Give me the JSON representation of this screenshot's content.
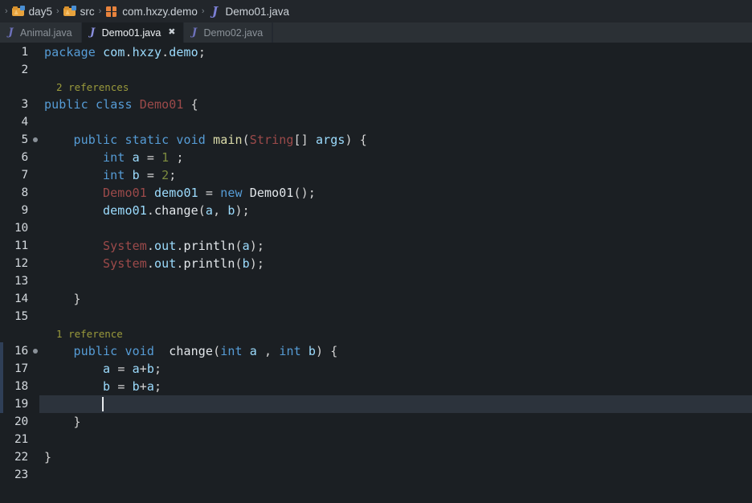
{
  "breadcrumb": {
    "items": [
      {
        "icon": "folder-icon",
        "label": "day5"
      },
      {
        "icon": "folder-icon",
        "label": "src"
      },
      {
        "icon": "package-icon",
        "label": "com.hxzy.demo"
      },
      {
        "icon": "java-file-icon",
        "label": "Demo01.java"
      }
    ],
    "separator": "›"
  },
  "tabs": [
    {
      "label": "Animal.java",
      "icon": "java-file-icon",
      "active": false,
      "close": ""
    },
    {
      "label": "Demo01.java",
      "icon": "java-file-icon",
      "active": true,
      "close": "✖"
    },
    {
      "label": "Demo02.java",
      "icon": "java-file-icon",
      "active": false,
      "close": ""
    }
  ],
  "editor": {
    "language": "java",
    "active_line": 19,
    "caret_line": 19,
    "caret_column": 9,
    "codelens": [
      {
        "after_line": 2,
        "text": "2 references"
      },
      {
        "after_line": 15,
        "text": "1 reference"
      }
    ],
    "run_markers": [
      5,
      16
    ],
    "edited_lines": [
      16,
      17,
      18,
      19
    ],
    "lines": [
      {
        "n": 1,
        "text": "package com.hxzy.demo;"
      },
      {
        "n": 2,
        "text": ""
      },
      {
        "n": 3,
        "text": "public class Demo01 {"
      },
      {
        "n": 4,
        "text": ""
      },
      {
        "n": 5,
        "text": "    public static void main(String[] args) {"
      },
      {
        "n": 6,
        "text": "        int a = 1 ;"
      },
      {
        "n": 7,
        "text": "        int b = 2;"
      },
      {
        "n": 8,
        "text": "        Demo01 demo01 = new Demo01();"
      },
      {
        "n": 9,
        "text": "        demo01.change(a, b);"
      },
      {
        "n": 10,
        "text": ""
      },
      {
        "n": 11,
        "text": "        System.out.println(a);"
      },
      {
        "n": 12,
        "text": "        System.out.println(b);"
      },
      {
        "n": 13,
        "text": ""
      },
      {
        "n": 14,
        "text": "    }"
      },
      {
        "n": 15,
        "text": ""
      },
      {
        "n": 16,
        "text": "    public void  change(int a , int b) {"
      },
      {
        "n": 17,
        "text": "        a = a+b;"
      },
      {
        "n": 18,
        "text": "        b = b+a;"
      },
      {
        "n": 19,
        "text": ""
      },
      {
        "n": 20,
        "text": "    }"
      },
      {
        "n": 21,
        "text": ""
      },
      {
        "n": 22,
        "text": "}"
      },
      {
        "n": 23,
        "text": ""
      }
    ]
  },
  "colors": {
    "editor_background": "#1b1f23",
    "tabbar_background": "#2b3035",
    "breadcrumb_background": "#22262b",
    "active_line_background": "#2c333c",
    "line_number": "#d3d8dd",
    "codelens": "#9a9a3c",
    "keyword": "#569cd6",
    "type": "#9c4a4a",
    "variable": "#9cdcfe",
    "function": "#dcdcaa",
    "number": "#7d8c3f",
    "plain": "#e3e7eb",
    "edit_marker": "#2f3f57"
  }
}
